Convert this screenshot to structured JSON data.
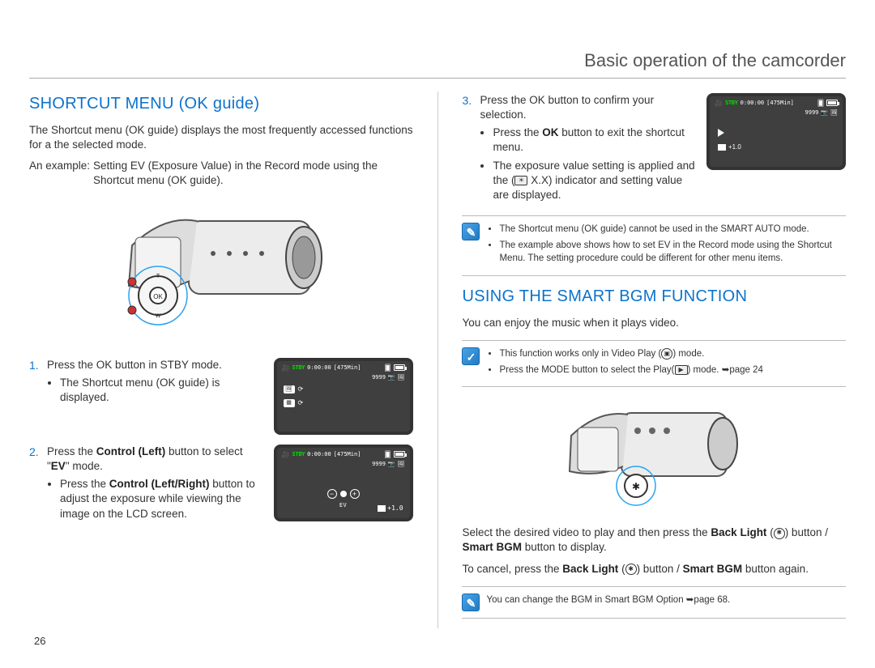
{
  "page_title": "Basic operation of the camcorder",
  "page_number": "26",
  "left": {
    "heading": "SHORTCUT MENU (OK guide)",
    "intro": "The Shortcut menu (OK guide) displays the most frequently accessed functions for a the selected mode.",
    "example_label": "An example:",
    "example_text": "Setting EV (Exposure Value) in the Record mode using the Shortcut menu (OK guide).",
    "steps": {
      "s1_main": "Press the OK button in STBY mode.",
      "s1_b1": "The Shortcut menu (OK guide) is displayed.",
      "s2_main_before": "Press the ",
      "s2_bold1": "Control (Left)",
      "s2_main_mid": " button to select \"",
      "s2_bold2": "EV",
      "s2_main_after": "\" mode.",
      "s2_b1_before": "Press the ",
      "s2_b1_bold": "Control (Left/Right)",
      "s2_b1_after": " button to adjust the exposure while viewing the image on the LCD screen."
    },
    "screen": {
      "stby": "STBY",
      "time": "0:00:00",
      "remaining": "[475Min]",
      "count": "9999",
      "ev_label": "EV",
      "ev_value": "+1.0"
    }
  },
  "right": {
    "step3_main": "Press the OK button to confirm your selection.",
    "step3_b1_before": "Press the ",
    "step3_b1_bold": "OK",
    "step3_b1_after": " button to exit the shortcut menu.",
    "step3_b2_before": "The exposure value setting is applied and the (",
    "step3_b2_xx": " X.X",
    "step3_b2_after": ") indicator and setting value are displayed.",
    "screen3": {
      "stby": "STBY",
      "time": "0:00:00",
      "remaining": "[475Min]",
      "count": "9999",
      "ev_value": "+1.0"
    },
    "note1_items": [
      "The Shortcut menu (OK guide) cannot be used in the SMART AUTO mode.",
      "The example above shows how to set EV in the Record mode using the Shortcut Menu. The setting procedure could be different for other menu items."
    ],
    "heading2": "USING THE SMART BGM FUNCTION",
    "intro2": "You can enjoy the music when it plays video.",
    "note2_items": {
      "a": "This function works only in Video Play (",
      "a_after": ") mode.",
      "b_before": "Press the MODE button to select the Play(",
      "b_after": ") mode. ",
      "b_ref": "➥page 24"
    },
    "select_before": "Select the desired video to play and then press the ",
    "select_bold1": "Back Light",
    "select_mid1": " (",
    "select_mid2": ") button / ",
    "select_bold2": "Smart BGM",
    "select_after": " button to display.",
    "cancel_before": "To cancel, press the ",
    "cancel_bold1": "Back Light",
    "cancel_mid1": " (",
    "cancel_mid2": ") button / ",
    "cancel_bold2": "Smart BGM",
    "cancel_after": " button again.",
    "note3": "You can change the BGM in Smart BGM Option ➥page 68."
  }
}
